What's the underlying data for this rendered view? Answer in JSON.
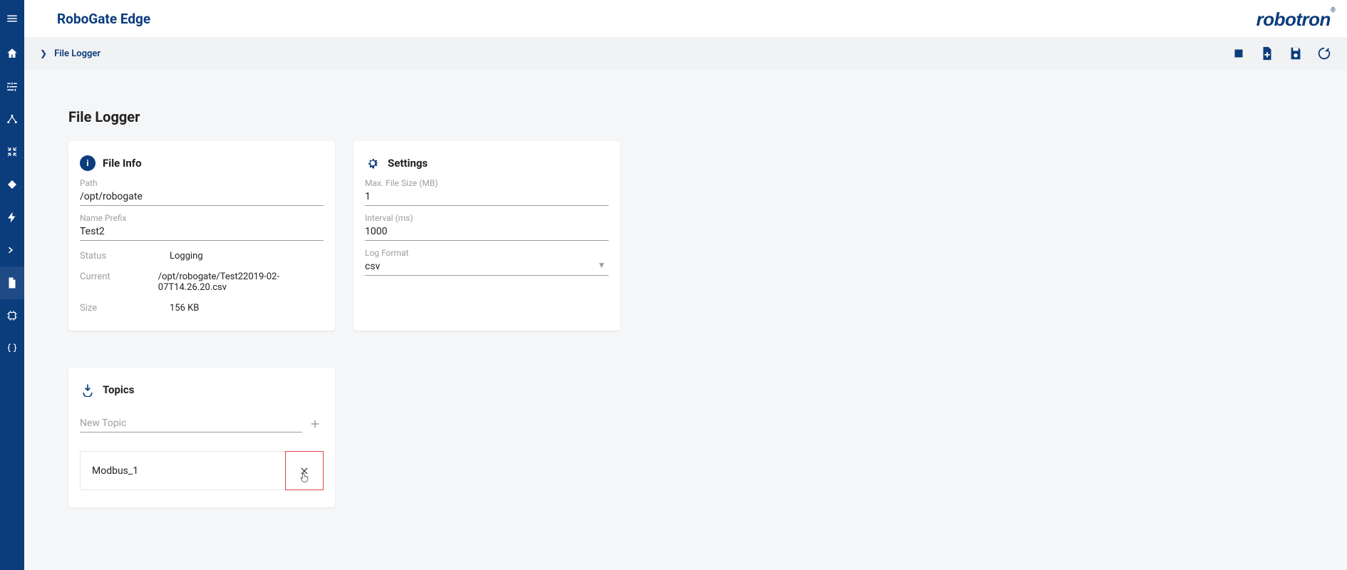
{
  "app": {
    "title": "RoboGate Edge",
    "brand": "robotron"
  },
  "breadcrumb": {
    "item": "File Logger"
  },
  "page": {
    "heading": "File Logger"
  },
  "cards": {
    "fileinfo": {
      "title": "File Info",
      "path_label": "Path",
      "path_value": "/opt/robogate",
      "prefix_label": "Name Prefix",
      "prefix_value": "Test2",
      "kv": {
        "status_k": "Status",
        "status_v": "Logging",
        "current_k": "Current",
        "current_v": "/opt/robogate/Test22019-02-07T14.26.20.csv",
        "size_k": "Size",
        "size_v": "156 KB"
      }
    },
    "settings": {
      "title": "Settings",
      "maxfs_label": "Max. File Size (MB)",
      "maxfs_value": "1",
      "interval_label": "Interval (ms)",
      "interval_value": "1000",
      "format_label": "Log Format",
      "format_value": "csv"
    },
    "topics": {
      "title": "Topics",
      "new_placeholder": "New Topic",
      "items": [
        {
          "name": "Modbus_1"
        }
      ]
    }
  }
}
